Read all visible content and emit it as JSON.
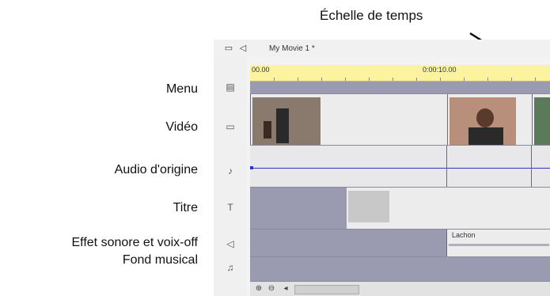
{
  "annotation": {
    "title": "Échelle de temps"
  },
  "labels": {
    "menu": "Menu",
    "video": "Vidéo",
    "audio_origin": "Audio d'origine",
    "title": "Titre",
    "sound_effect": "Effet sonore et  voix-off",
    "background_music": "Fond musical"
  },
  "window": {
    "title": "My Movie 1 *",
    "ruler": {
      "start": "00.00",
      "mark": "0:00:10.00"
    },
    "clips": {
      "sound_clip_label": "Lachon"
    }
  },
  "icons": {
    "toolbar": [
      "timeline-view-icon",
      "audio-view-icon"
    ],
    "tracks": [
      "menu-track-icon",
      "video-track-icon",
      "audio-origin-icon",
      "title-track-icon",
      "sound-effect-icon",
      "music-track-icon"
    ],
    "scroll": [
      "zoom-in-icon",
      "zoom-out-icon",
      "scroll-left-icon"
    ]
  },
  "colors": {
    "ruler": "#fbf3a0",
    "track_grey": "#9a9ab0",
    "audio_line": "#3333cc"
  }
}
